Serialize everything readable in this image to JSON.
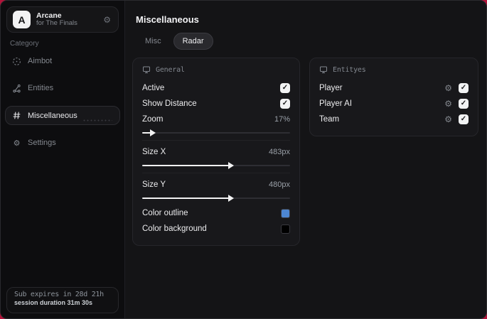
{
  "sidebar": {
    "brand": {
      "initial": "A",
      "title": "Arcane",
      "subtitle": "for The Finals"
    },
    "category_label": "Category",
    "items": [
      {
        "label": "Aimbot"
      },
      {
        "label": "Entities"
      },
      {
        "label": "Miscellaneous"
      },
      {
        "label": "Settings"
      }
    ],
    "footer": {
      "line1": "Sub expires in 28d 21h",
      "line2": "session duration 31m 30s"
    }
  },
  "main": {
    "title": "Miscellaneous",
    "tabs": [
      {
        "label": "Misc"
      },
      {
        "label": "Radar"
      }
    ],
    "general": {
      "title": "General",
      "toggles": [
        {
          "label": "Active",
          "checked": true
        },
        {
          "label": "Show Distance",
          "checked": true
        }
      ],
      "sliders": [
        {
          "label": "Zoom",
          "value": "17%",
          "percent": 7
        },
        {
          "label": "Size X",
          "value": "483px",
          "percent": 60
        },
        {
          "label": "Size Y",
          "value": "480px",
          "percent": 60
        }
      ],
      "colors": [
        {
          "label": "Color outline",
          "hex": "#4d86d2"
        },
        {
          "label": "Color background",
          "hex": "#000000"
        }
      ]
    },
    "entities": {
      "title": "Entityes",
      "rows": [
        {
          "label": "Player",
          "checked": true
        },
        {
          "label": "Player AI",
          "checked": true
        },
        {
          "label": "Team",
          "checked": true
        }
      ]
    }
  },
  "icons": {
    "check": "✓",
    "gear": "⚙"
  },
  "colors": {
    "desktop_accent": "#b11339",
    "window_bg": "#141416",
    "sidebar_bg": "#0d0d0f",
    "panel_bg": "#18181b",
    "outline_swatch": "#4d86d2",
    "background_swatch": "#000000"
  }
}
